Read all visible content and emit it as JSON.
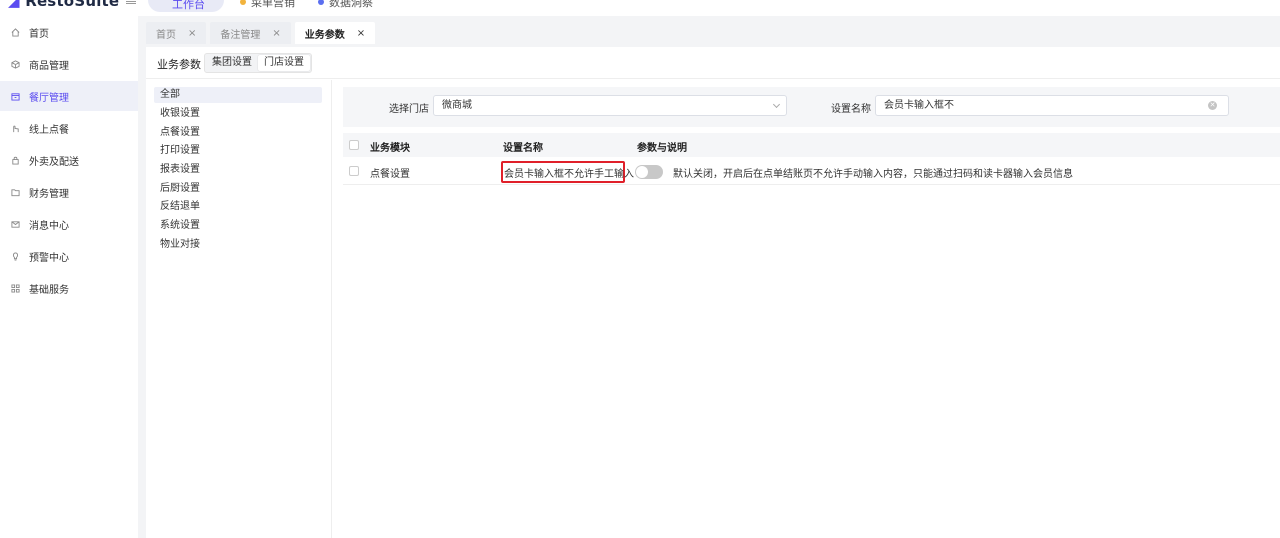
{
  "header": {
    "logo": "RestoSuite",
    "pill_label": "工作台",
    "items": [
      {
        "label": "菜单营销",
        "color": "#f2b33d"
      },
      {
        "label": "数据洞察",
        "color": "#5b6ff0"
      }
    ]
  },
  "sidebar": {
    "items": [
      {
        "label": "首页",
        "icon": "home-icon"
      },
      {
        "label": "商品管理",
        "icon": "box-icon"
      },
      {
        "label": "餐厅管理",
        "icon": "store-icon",
        "active": true
      },
      {
        "label": "线上点餐",
        "icon": "hand-icon"
      },
      {
        "label": "外卖及配送",
        "icon": "bag-icon"
      },
      {
        "label": "财务管理",
        "icon": "folder-icon"
      },
      {
        "label": "消息中心",
        "icon": "mail-icon"
      },
      {
        "label": "预警中心",
        "icon": "bulb-icon"
      },
      {
        "label": "基础服务",
        "icon": "grid-icon"
      }
    ]
  },
  "tabs": [
    {
      "label": "首页",
      "active": false
    },
    {
      "label": "备注管理",
      "active": false
    },
    {
      "label": "业务参数",
      "active": true
    }
  ],
  "tab_close": "×",
  "main": {
    "title": "业务参数",
    "segments": [
      {
        "label": "集团设置",
        "active": false
      },
      {
        "label": "门店设置",
        "active": true
      }
    ],
    "categories": [
      "全部",
      "收银设置",
      "点餐设置",
      "打印设置",
      "报表设置",
      "后厨设置",
      "反结退单",
      "系统设置",
      "物业对接"
    ],
    "filter": {
      "store_label": "选择门店",
      "store_value": "微商城",
      "name_label": "设置名称",
      "name_value": "会员卡输入框不"
    },
    "table": {
      "columns": [
        "业务模块",
        "设置名称",
        "参数与说明"
      ],
      "rows": [
        {
          "module": "点餐设置",
          "name": "会员卡输入框不允许手工输入",
          "enabled": false,
          "description": "默认关闭，开启后在点单结账页不允许手动输入内容，只能通过扫码和读卡器输入会员信息"
        }
      ]
    }
  }
}
